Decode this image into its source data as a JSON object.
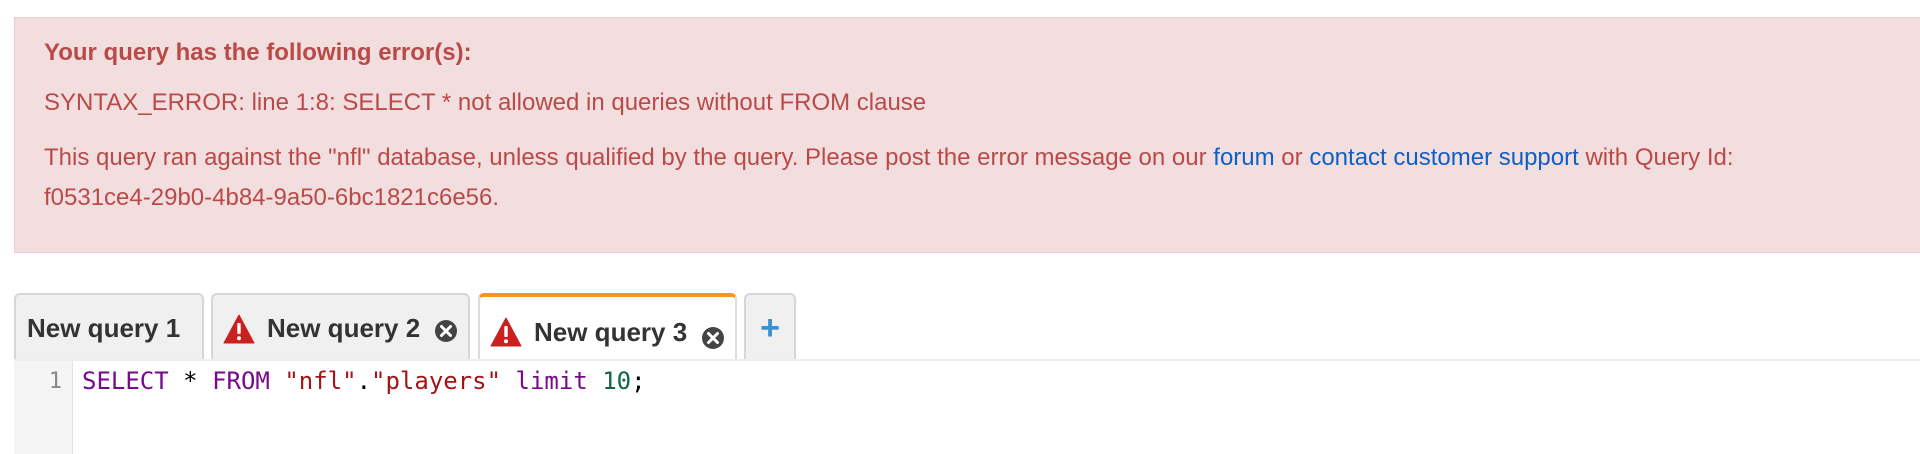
{
  "error": {
    "title": "Your query has the following error(s):",
    "message": "SYNTAX_ERROR: line 1:8: SELECT * not allowed in queries without FROM clause",
    "details_prefix": "This query ran against the \"nfl\" database, unless qualified by the query. Please post the error message on our ",
    "forum_link": "forum",
    "or_text": " or ",
    "support_link": "contact customer support",
    "details_suffix": " with Query Id:",
    "query_id": "f0531ce4-29b0-4b84-9a50-6bc1821c6e56."
  },
  "tabs": [
    {
      "label": "New query 1",
      "has_error": false,
      "closable": false,
      "active": false
    },
    {
      "label": "New query 2",
      "has_error": true,
      "closable": true,
      "active": false
    },
    {
      "label": "New query 3",
      "has_error": true,
      "closable": true,
      "active": true
    }
  ],
  "add_tab_label": "+",
  "editor": {
    "line_number": "1",
    "tokens": {
      "select": "SELECT",
      "star": " * ",
      "from": "FROM",
      "sp1": " ",
      "db": "\"nfl\"",
      "dot": ".",
      "table": "\"players\"",
      "sp2": " ",
      "limit": "limit",
      "sp3": " ",
      "num": "10",
      "semi": ";"
    }
  },
  "colors": {
    "error_text": "#b94a48",
    "error_bg": "#f2dede",
    "link": "#0f5fc5",
    "active_tab_accent": "#f49a1b",
    "warning_icon": "#cc1f1f",
    "add_icon": "#3a8fd0"
  },
  "icons": {
    "warning": "warning-triangle-icon",
    "close": "close-circle-icon",
    "add": "plus-icon"
  }
}
